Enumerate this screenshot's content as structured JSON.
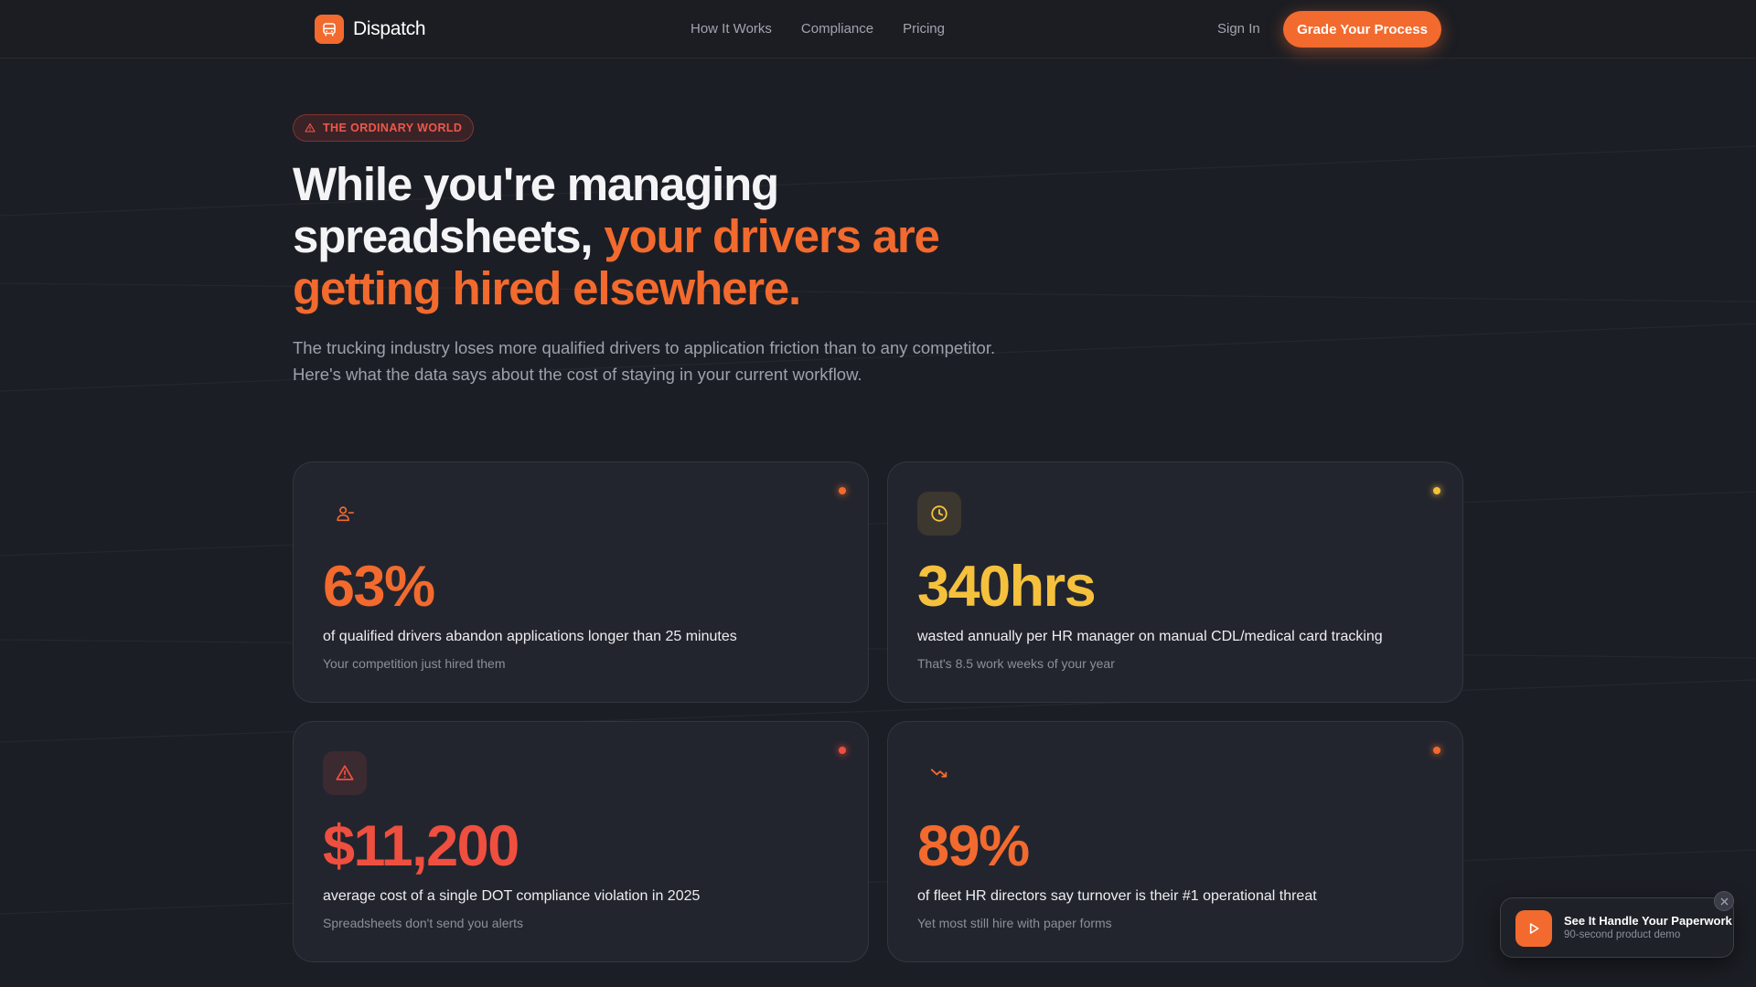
{
  "brand": {
    "name": "Dispatch",
    "icon": "truck-icon"
  },
  "nav": {
    "links": [
      "How It Works",
      "Compliance",
      "Pricing"
    ],
    "sign_in": "Sign In",
    "cta": "Grade Your Process"
  },
  "hero": {
    "eyebrow": "THE ORDINARY WORLD",
    "eyebrow_icon": "warning-triangle-icon",
    "headline_plain": "While you're managing spreadsheets, ",
    "headline_accent": "your drivers are getting hired elsewhere.",
    "subtext_line1": "The trucking industry loses more qualified drivers to application friction than to any competitor.",
    "subtext_line2": "Here's what the data says about the cost of staying in your current workflow."
  },
  "stats": [
    {
      "value": "63%",
      "description": "of qualified drivers abandon applications longer than 25 minutes",
      "note": "Your competition just hired them",
      "icon": "user-minus-icon",
      "color": "#f26a2e"
    },
    {
      "value": "340hrs",
      "description": "wasted annually per HR manager on manual CDL/medical card tracking",
      "note": "That's 8.5 work weeks of your year",
      "icon": "clock-icon",
      "color": "#f5c13d"
    },
    {
      "value": "$11,200",
      "description": "average cost of a single DOT compliance violation in 2025",
      "note": "Spreadsheets don't send you alerts",
      "icon": "warning-triangle-icon",
      "color": "#ef4f3f"
    },
    {
      "value": "89%",
      "description": "of fleet HR directors say turnover is their #1 operational threat",
      "note": "Yet most still hire with paper forms",
      "icon": "trending-down-icon",
      "color": "#f26a2e"
    }
  ],
  "demo": {
    "title": "See It Handle Your Paperwork",
    "subtitle": "90-second product demo",
    "icon": "play-icon"
  },
  "colors": {
    "background": "#1c1e25",
    "card": "#23252e",
    "accent": "#f26a2e",
    "amber": "#f5c13d",
    "red": "#ef4f3f"
  }
}
